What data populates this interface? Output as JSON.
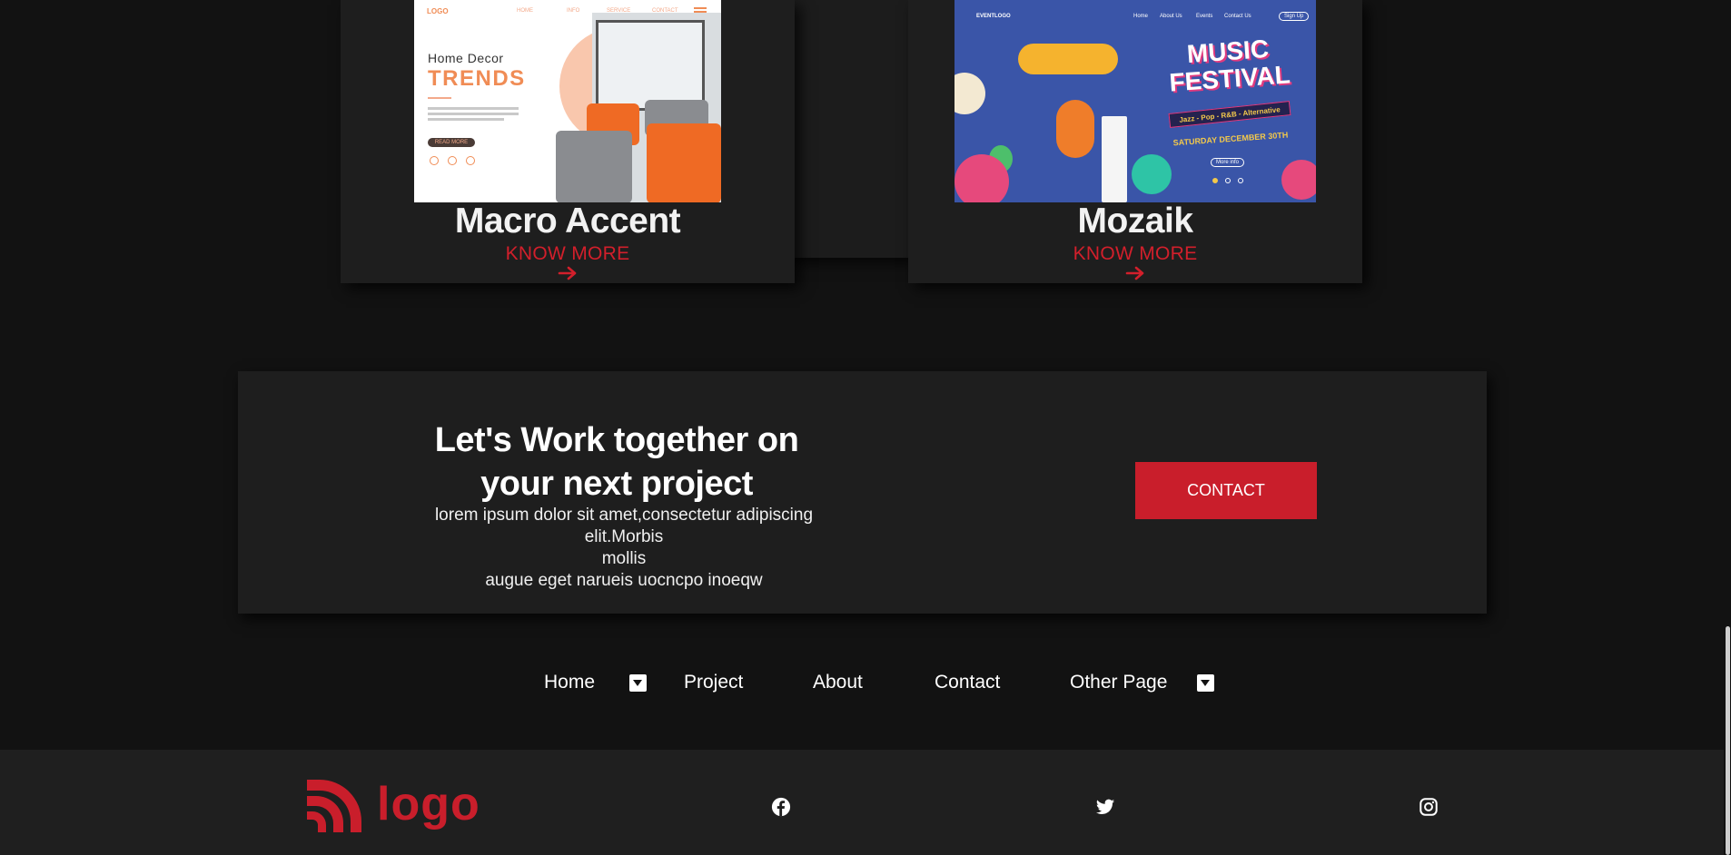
{
  "projects": [
    {
      "title": "Macro Accent",
      "link_label": "KNOW MORE",
      "preview": {
        "logo": "LOGO",
        "nav": [
          "HOME",
          "INFO",
          "SERVICE",
          "CONTACT"
        ],
        "subtitle": "Home  Decor",
        "heading": "TRENDS",
        "button": "READ MORE",
        "accent_color": "#f08c55"
      }
    },
    {
      "title": "Mozaik",
      "link_label": "KNOW MORE",
      "preview": {
        "logo": "EVENTLOGO",
        "nav": [
          "Home",
          "About Us",
          "Events",
          "Contact Us"
        ],
        "signup": "Sign Up",
        "heading_line1": "MUSIC",
        "heading_line2": "FESTIVAL",
        "tags": "Jazz - Pop - R&B - Alternative",
        "date": "SATURDAY DECEMBER 30TH",
        "button": "More info",
        "background_color": "#3a55a8"
      }
    }
  ],
  "cta": {
    "title_line1": "Let's Work together on",
    "title_line2": "your next project",
    "text_line1": "lorem ipsum dolor sit amet,consectetur adipiscing elit.Morbis",
    "text_line2": "mollis",
    "text_line3": "augue eget narueis uocncpo inoeqw",
    "button_label": "CONTACT"
  },
  "nav": {
    "items": [
      "Home",
      "Project",
      "About",
      "Contact",
      "Other Page"
    ],
    "dropdown_icon": "caret-down-square-icon"
  },
  "footer": {
    "logo_text": "logo",
    "social_icons": [
      "facebook-icon",
      "twitter-icon",
      "instagram-icon"
    ]
  },
  "colors": {
    "page_background": "#121212",
    "card_background": "#1e1e1e",
    "accent": "#c91e2b",
    "footer_background": "#1f1f1f"
  }
}
